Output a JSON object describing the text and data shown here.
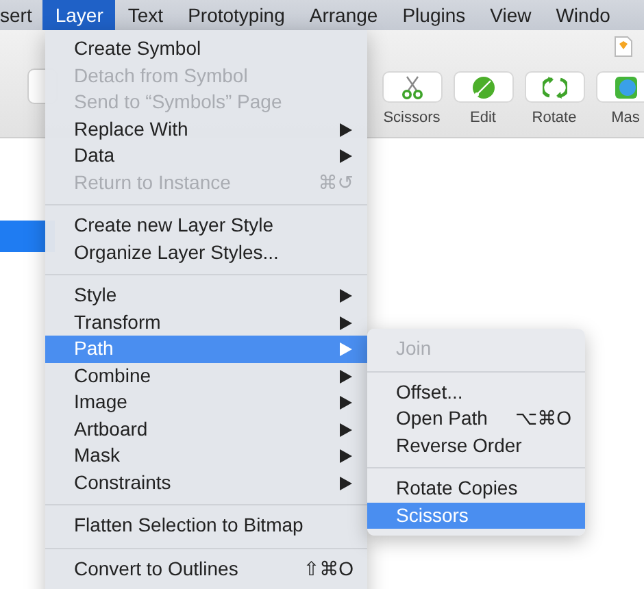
{
  "menu_bar": [
    {
      "label": "sert",
      "selected": false
    },
    {
      "label": "Layer",
      "selected": true
    },
    {
      "label": "Text",
      "selected": false
    },
    {
      "label": "Prototyping",
      "selected": false
    },
    {
      "label": "Arrange",
      "selected": false
    },
    {
      "label": "Plugins",
      "selected": false
    },
    {
      "label": "View",
      "selected": false
    },
    {
      "label": "Windo",
      "selected": false
    }
  ],
  "toolbar": {
    "buttons": [
      {
        "label": "Scissors"
      },
      {
        "label": "Edit"
      },
      {
        "label": "Rotate"
      },
      {
        "label": "Mas"
      }
    ]
  },
  "layer_menu": {
    "items": [
      {
        "kind": "item",
        "label": "Create Symbol",
        "disabled": false,
        "submenu": false,
        "selected": false
      },
      {
        "kind": "item",
        "label": "Detach from Symbol",
        "disabled": true,
        "submenu": false,
        "selected": false
      },
      {
        "kind": "item",
        "label": "Send to “Symbols” Page",
        "disabled": true,
        "submenu": false,
        "selected": false
      },
      {
        "kind": "item",
        "label": "Replace With",
        "disabled": false,
        "submenu": true,
        "selected": false
      },
      {
        "kind": "item",
        "label": "Data",
        "disabled": false,
        "submenu": true,
        "selected": false
      },
      {
        "kind": "item",
        "label": "Return to Instance",
        "disabled": true,
        "submenu": false,
        "selected": false,
        "shortcut": "⌘↺"
      },
      {
        "kind": "separator"
      },
      {
        "kind": "item",
        "label": "Create new Layer Style",
        "disabled": false,
        "submenu": false,
        "selected": false
      },
      {
        "kind": "item",
        "label": "Organize Layer Styles...",
        "disabled": false,
        "submenu": false,
        "selected": false
      },
      {
        "kind": "separator"
      },
      {
        "kind": "item",
        "label": "Style",
        "disabled": false,
        "submenu": true,
        "selected": false
      },
      {
        "kind": "item",
        "label": "Transform",
        "disabled": false,
        "submenu": true,
        "selected": false
      },
      {
        "kind": "item",
        "label": "Path",
        "disabled": false,
        "submenu": true,
        "selected": true
      },
      {
        "kind": "item",
        "label": "Combine",
        "disabled": false,
        "submenu": true,
        "selected": false
      },
      {
        "kind": "item",
        "label": "Image",
        "disabled": false,
        "submenu": true,
        "selected": false
      },
      {
        "kind": "item",
        "label": "Artboard",
        "disabled": false,
        "submenu": true,
        "selected": false
      },
      {
        "kind": "item",
        "label": "Mask",
        "disabled": false,
        "submenu": true,
        "selected": false
      },
      {
        "kind": "item",
        "label": "Constraints",
        "disabled": false,
        "submenu": true,
        "selected": false
      },
      {
        "kind": "separator"
      },
      {
        "kind": "item",
        "label": "Flatten Selection to Bitmap",
        "disabled": false,
        "submenu": false,
        "selected": false
      },
      {
        "kind": "separator"
      },
      {
        "kind": "item",
        "label": "Convert to Outlines",
        "disabled": false,
        "submenu": false,
        "selected": false,
        "shortcut": "⇧⌘O"
      }
    ]
  },
  "path_submenu": {
    "items": [
      {
        "kind": "item",
        "label": "Join",
        "disabled": true,
        "selected": false
      },
      {
        "kind": "separator"
      },
      {
        "kind": "item",
        "label": "Offset...",
        "disabled": false,
        "selected": false
      },
      {
        "kind": "item",
        "label": "Open Path",
        "disabled": false,
        "selected": false,
        "shortcut": "⌥⌘O"
      },
      {
        "kind": "item",
        "label": "Reverse Order",
        "disabled": false,
        "selected": false
      },
      {
        "kind": "separator"
      },
      {
        "kind": "item",
        "label": "Rotate Copies",
        "disabled": false,
        "selected": false
      },
      {
        "kind": "item",
        "label": "Scissors",
        "disabled": false,
        "selected": true
      }
    ]
  }
}
